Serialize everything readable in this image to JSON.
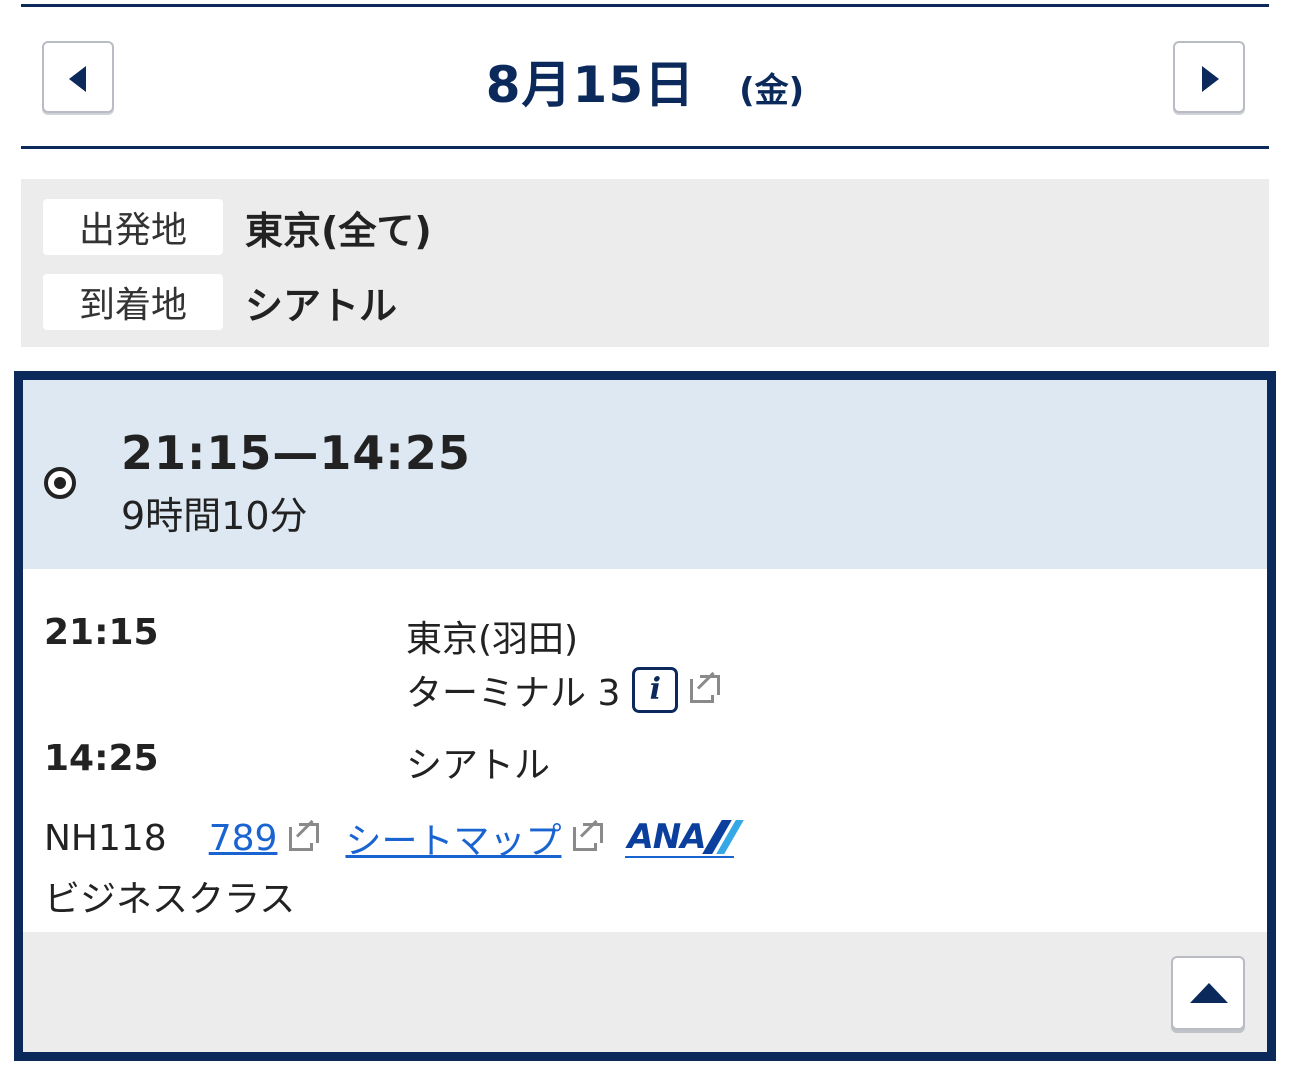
{
  "date_nav": {
    "date": "8月15日",
    "weekday": "(金)",
    "prev_icon": "triangle-left-icon",
    "next_icon": "triangle-right-icon"
  },
  "route": {
    "origin_label": "出発地",
    "origin_value": "東京(全て)",
    "destination_label": "到着地",
    "destination_value": "シアトル"
  },
  "result": {
    "times": "21:15—14:25",
    "duration": "9時間10分",
    "departure": {
      "time": "21:15",
      "airport": "東京(羽田)",
      "terminal": "ターミナル 3",
      "info_icon_label": "i"
    },
    "arrival": {
      "time": "14:25",
      "airport": "シアトル"
    },
    "flight": {
      "number": "NH118",
      "aircraft": "789",
      "seatmap": "シートマップ",
      "airline_logo": "ANA",
      "cabin": "ビジネスクラス"
    }
  },
  "colors": {
    "navy": "#0b2a5b",
    "card_header_bg": "#dde8f3",
    "gray_bg": "#ececec",
    "link": "#1a64d1"
  }
}
